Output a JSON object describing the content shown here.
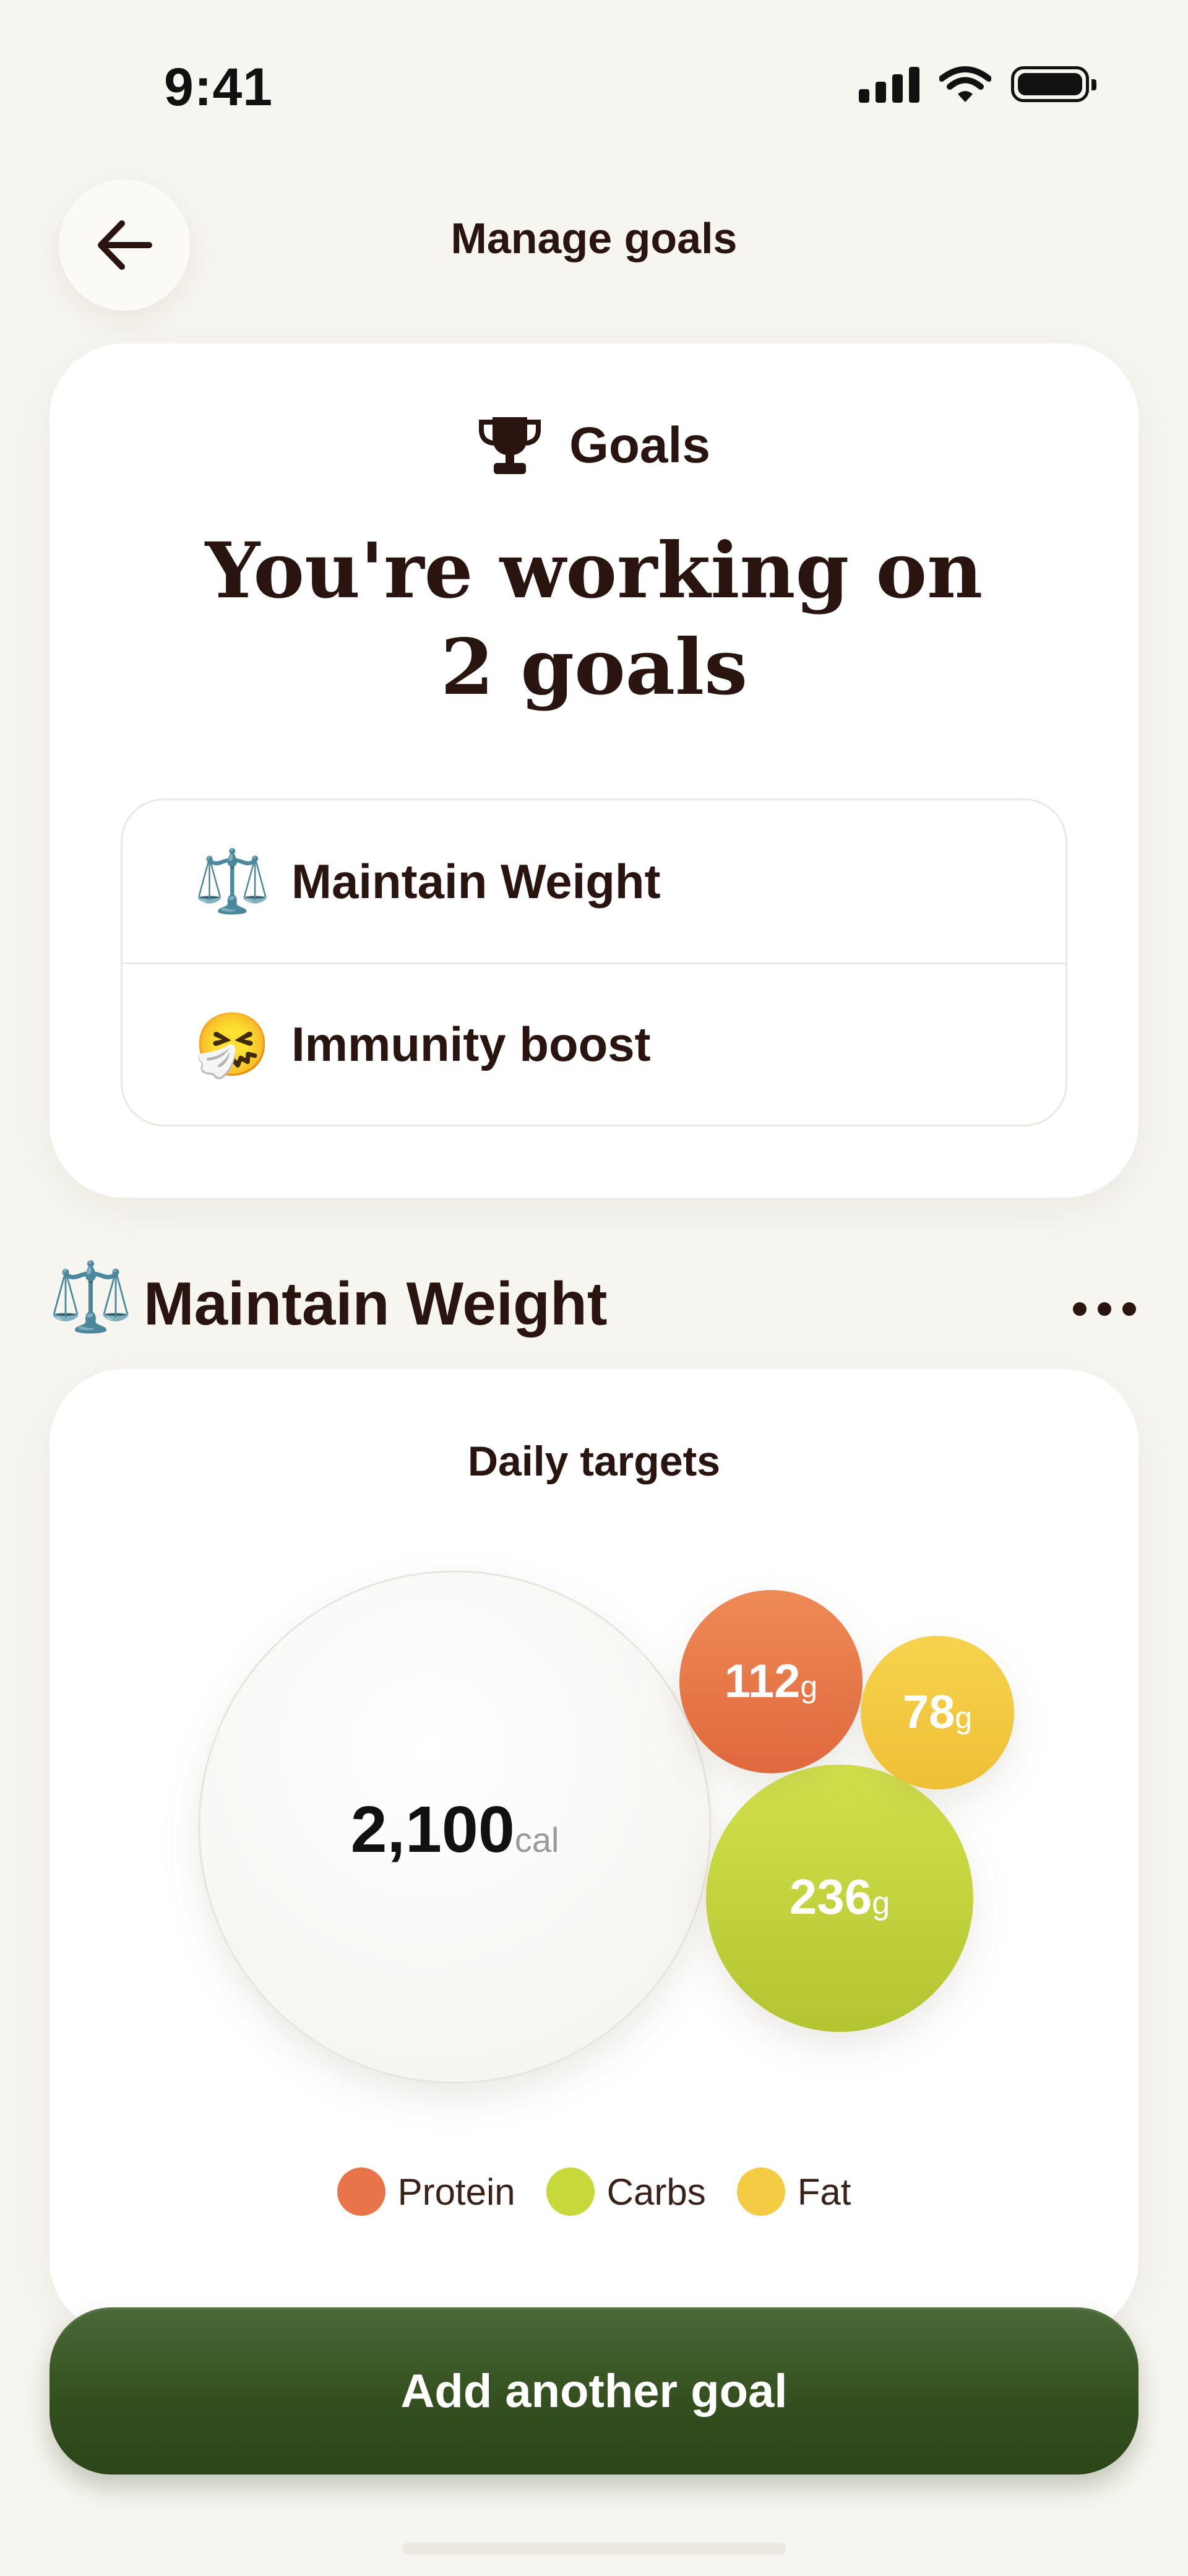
{
  "status_bar": {
    "time": "9:41"
  },
  "header": {
    "title": "Manage goals"
  },
  "goals_card": {
    "heading": "Goals",
    "headline_line1": "You're working on",
    "headline_line2": "2 goals",
    "goals": [
      {
        "icon": "⚖️",
        "label": "Maintain Weight"
      },
      {
        "icon": "🤧",
        "label": "Immunity boost"
      }
    ]
  },
  "section": {
    "icon": "⚖️",
    "title": "Maintain Weight"
  },
  "targets": {
    "title": "Daily targets",
    "calories": {
      "value": "2,100",
      "unit": "cal"
    },
    "macros": [
      {
        "name": "Protein",
        "value": "112",
        "unit": "g",
        "color": "#e8744a"
      },
      {
        "name": "Fat",
        "value": "78",
        "unit": "g",
        "color": "#f4cb43"
      },
      {
        "name": "Carbs",
        "value": "236",
        "unit": "g",
        "color": "#c6d83a"
      }
    ]
  },
  "cta": {
    "label": "Add another goal"
  },
  "colors": {
    "accent": "#34501f",
    "text": "#2a1410",
    "background": "#f7f5f0"
  }
}
